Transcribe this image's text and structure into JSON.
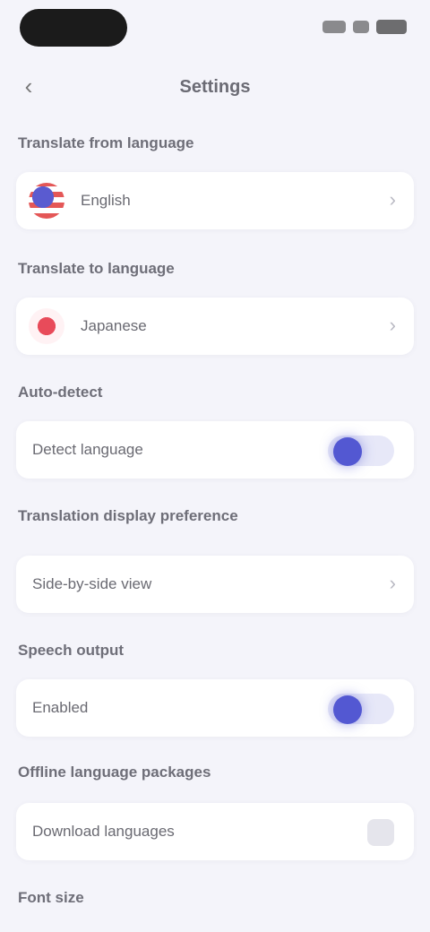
{
  "nav": {
    "title": "Settings",
    "back_icon": "chevron-left-icon"
  },
  "sections": [
    {
      "label": "Translate from language",
      "value": "English",
      "control": "chevron",
      "flag": "us"
    },
    {
      "label": "Translate to language",
      "value": "Japanese",
      "control": "chevron",
      "flag": "jp"
    },
    {
      "label": "Auto-detect",
      "value": "Detect language",
      "control": "toggle",
      "toggle_on": true
    },
    {
      "label": "Translation display preference",
      "value": "Side-by-side view",
      "control": "chevron"
    },
    {
      "label": "Speech output",
      "value": "Enabled",
      "control": "toggle",
      "toggle_on": true
    },
    {
      "label": "Offline language packages",
      "value": "Download languages",
      "control": "stepper"
    },
    {
      "label": "Font size"
    }
  ],
  "colors": {
    "accent": "#5358d2",
    "background": "#f4f4fa",
    "card": "#ffffff"
  }
}
